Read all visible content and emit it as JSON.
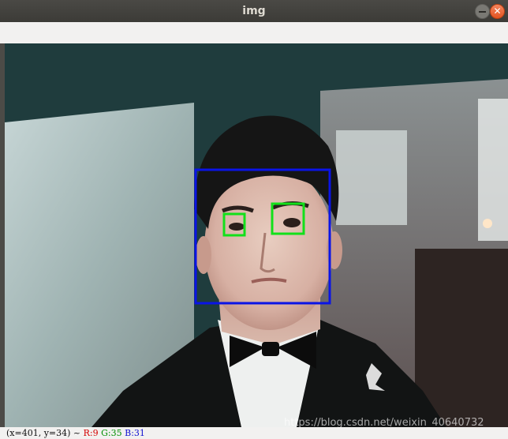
{
  "window": {
    "title": "img"
  },
  "status": {
    "coords": "(x=401, y=34) ~",
    "r": "R:9",
    "g": "G:35",
    "b": "B:31"
  },
  "watermark": "https://blog.csdn.net/weixin_40640732",
  "colors": {
    "face_box": "#0a14e6",
    "eye_box": "#12e01a",
    "close_button": "#e95420"
  },
  "icons": {
    "minimize": "minimize-icon",
    "close": "close-icon"
  }
}
